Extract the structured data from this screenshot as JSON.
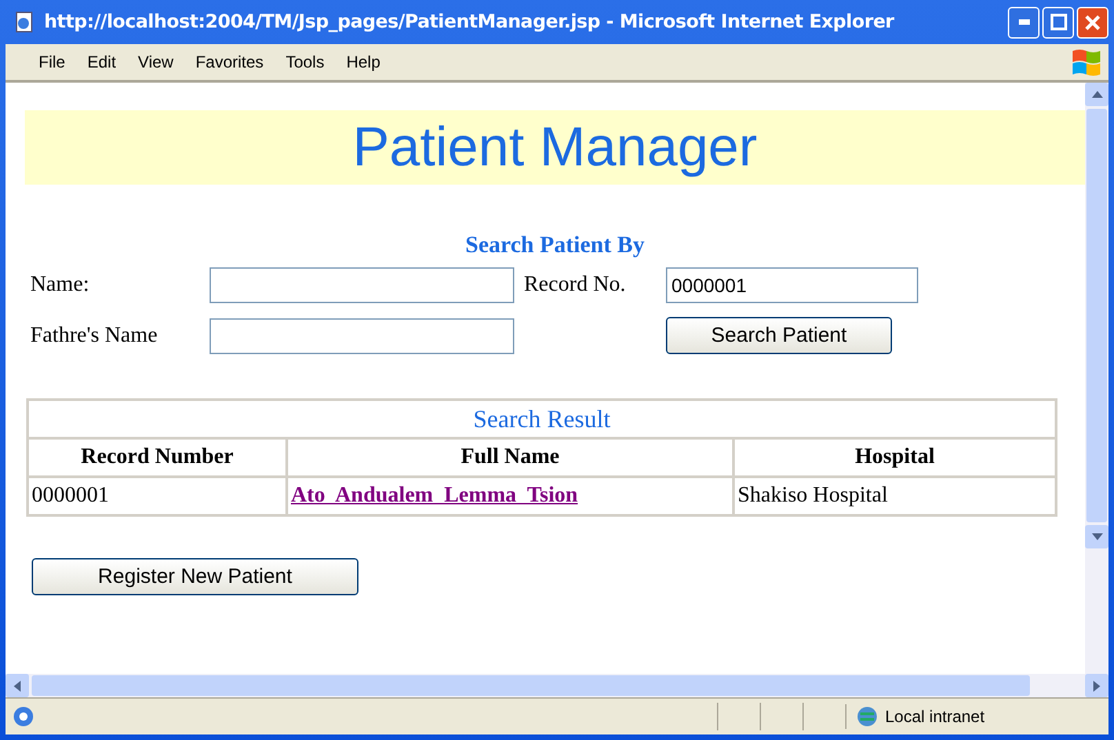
{
  "window": {
    "title": "http://localhost:2004/TM/Jsp_pages/PatientManager.jsp - Microsoft Internet Explorer"
  },
  "menu": [
    "File",
    "Edit",
    "View",
    "Favorites",
    "Tools",
    "Help"
  ],
  "page": {
    "banner": "Patient Manager",
    "search_heading": "Search Patient By",
    "fields": [
      {
        "label": "Name:"
      },
      {
        "label": "Record No.",
        "value": "0000001"
      },
      {
        "label": "Fathre's Name"
      }
    ],
    "search_button": "Search Patient",
    "results": {
      "caption": "Search Result",
      "columns": [
        "Record Number",
        "Full Name",
        "Hospital"
      ],
      "rows": [
        {
          "record": "0000001",
          "name": "Ato  Andualem  Lemma  Tsion",
          "hospital": "Shakiso Hospital"
        }
      ]
    },
    "register_button": "Register New Patient"
  },
  "status_bar": {
    "zone": "Local intranet"
  }
}
